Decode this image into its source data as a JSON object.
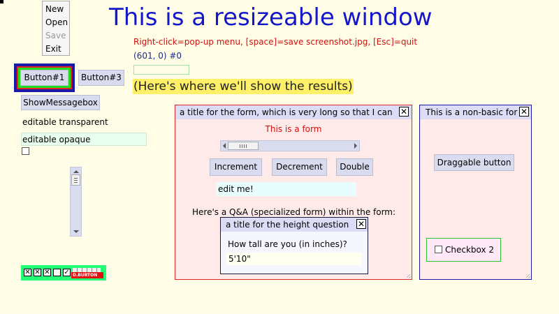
{
  "menu": {
    "items": [
      "New",
      "Open",
      "Save",
      "Exit"
    ]
  },
  "title": "This is a resizeable window",
  "instructions": "Right-click=pop-up menu,  [space]=save screenshot.jpg,  [Esc]=quit",
  "coords": "(601, 0) #0",
  "results": "(Here's where we'll show the results)",
  "left": {
    "button1": "Button#1",
    "button3": "Button#3",
    "show_message_box": "ShowMessagebox",
    "editable_transparent": "editable transparent",
    "editable_opaque": "editable opaque"
  },
  "form": {
    "title": "a title for the form, which is very long so that I can",
    "heading": "This is a form",
    "buttons": {
      "increment": "Increment",
      "decrement": "Decrement",
      "double": "Double"
    },
    "edit_value": "edit me!",
    "qa_caption": "Here's a Q&A (specialized form) within the form:"
  },
  "qa": {
    "title": "a title for the height question",
    "question": "How tall are you (in inches)?",
    "answer": "5'10\""
  },
  "nonbasic": {
    "title": "This is a non-basic for",
    "draggable_button": "Draggable button",
    "checkbox_label": "Checkbox 2"
  },
  "widget_strip": {
    "logo_text": "D.BURTON"
  },
  "colors": {
    "background": "#fffde6",
    "title_blue": "#1418c8",
    "instructions_red": "#d01010",
    "coords_blue": "#1a2c8e",
    "results_highlight": "#fff06a",
    "form_background": "#ffeaea",
    "form_border": "#e02828",
    "nonbasic_border": "#1a1aa8",
    "titlebar": "#dcdcf6",
    "button_bg": "#d8dcee",
    "widget_green": "#22ff77"
  }
}
